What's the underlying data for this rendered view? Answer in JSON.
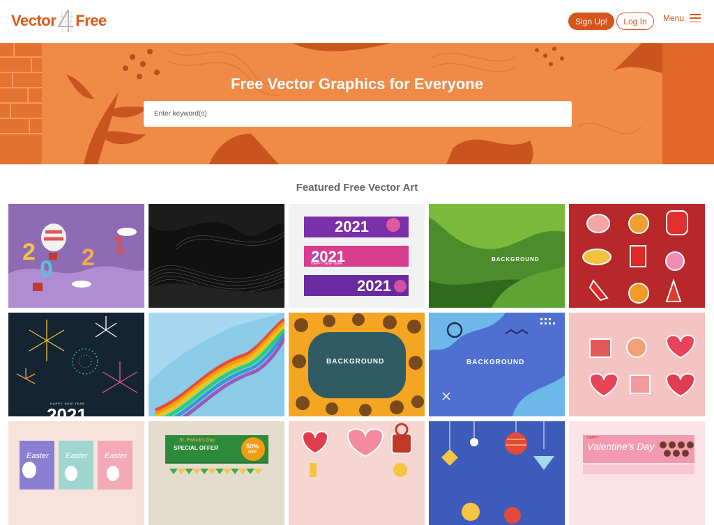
{
  "brand": {
    "name_left": "Vector",
    "name_right": "Free",
    "logo_digit": "4"
  },
  "header": {
    "signup_label": "Sign Up!",
    "login_label": "Log In",
    "menu_label": "Menu"
  },
  "hero": {
    "title": "Free Vector Graphics for Everyone",
    "search_placeholder": "Enter keyword(s)"
  },
  "featured": {
    "title": "Featured Free Vector Art",
    "cards": [
      {
        "name": "2021-balloons"
      },
      {
        "name": "black-waves"
      },
      {
        "name": "2021-banners",
        "year": "2021",
        "sub": "HAPPY NEW YEAR"
      },
      {
        "name": "green-background",
        "label": "BACKGROUND"
      },
      {
        "name": "red-stickers"
      },
      {
        "name": "fireworks",
        "greeting": "HAPPY NEW YEAR",
        "year": "2021"
      },
      {
        "name": "rainbow-wave"
      },
      {
        "name": "sunflower-background",
        "label": "BACKGROUND"
      },
      {
        "name": "blue-background",
        "label": "BACKGROUND"
      },
      {
        "name": "valentine-stickers"
      },
      {
        "name": "easter-cards",
        "label": "Easter"
      },
      {
        "name": "st-patricks-banner",
        "line1": "St. Patrick's Day",
        "line2": "SPECIAL OFFER",
        "badge1": "50%",
        "badge2": "OFF"
      },
      {
        "name": "love-stickers"
      },
      {
        "name": "christmas-ornaments"
      },
      {
        "name": "valentines-banner",
        "small": "HAPPY",
        "label": "Valentine's Day"
      }
    ]
  },
  "colors": {
    "brand": "#d9541a",
    "hero": "#f08a47"
  }
}
